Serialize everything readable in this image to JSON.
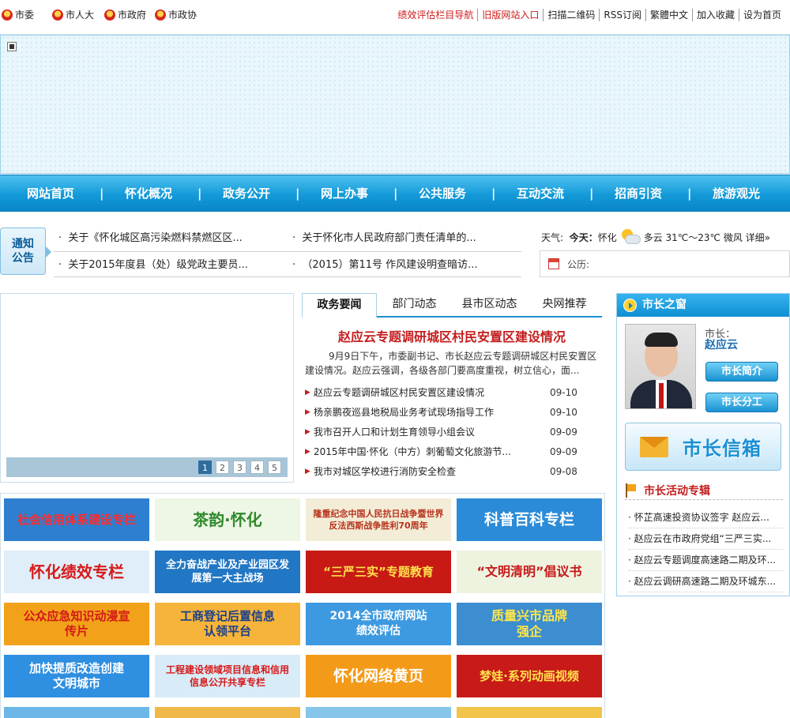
{
  "topbar": {
    "left_links": [
      {
        "label": "市委"
      },
      {
        "label": "市人大"
      },
      {
        "label": "市政府"
      },
      {
        "label": "市政协"
      }
    ],
    "right_links": [
      {
        "label": "绩效评估栏目导航",
        "color": "#d01b1b"
      },
      {
        "label": "旧版网站入口",
        "color": "#d01b1b"
      },
      {
        "label": "扫描二维码",
        "color": "#222222"
      },
      {
        "label": "RSS订阅",
        "color": "#222222"
      },
      {
        "label": "繁體中文",
        "color": "#222222"
      },
      {
        "label": "加入收藏",
        "color": "#222222"
      },
      {
        "label": "设为首页",
        "color": "#222222"
      }
    ]
  },
  "nav": {
    "items": [
      "网站首页",
      "怀化概况",
      "政务公开",
      "网上办事",
      "公共服务",
      "互动交流",
      "招商引资",
      "旅游观光"
    ],
    "separator": "|"
  },
  "notice": {
    "badge_line1": "通知",
    "badge_line2": "公告",
    "bullet": "·",
    "items": [
      "关于《怀化城区高污染燃料禁燃区区...",
      "关于怀化市人民政府部门责任清单的...",
      "关于2015年度县（处）级党政主要员...",
      "（2015）第11号 作风建设明查暗访..."
    ]
  },
  "weather": {
    "label": "天气:",
    "today_label": "今天：",
    "city": "怀化",
    "description": "多云 31℃～23℃ 微风",
    "detail_link": "详细»"
  },
  "almanac": {
    "label": "公历:"
  },
  "slideshow": {
    "pages": [
      "1",
      "2",
      "3",
      "4",
      "5"
    ],
    "active_page": "1"
  },
  "news": {
    "tabs": [
      "政务要闻",
      "部门动态",
      "县市区动态",
      "央网推荐"
    ],
    "active_tab": "政务要闻",
    "headline": "赵应云专题调研城区村民安置区建设情况",
    "summary": "9月9日下午，市委副书记、市长赵应云专题调研城区村民安置区建设情况。赵应云强调，各级各部门要高度重视，树立信心，面...",
    "items": [
      {
        "title": "赵应云专题调研城区村民安置区建设情况",
        "date": "09-10"
      },
      {
        "title": "杨亲鹏夜巡县地税局业务考试现场指导工作",
        "date": "09-10"
      },
      {
        "title": "我市召开人口和计划生育领导小组会议",
        "date": "09-09"
      },
      {
        "title": "2015年中国·怀化（中方）刺葡萄文化旅游节...",
        "date": "09-09"
      },
      {
        "title": "我市对城区学校进行消防安全检查",
        "date": "09-08"
      }
    ]
  },
  "mayor": {
    "header": "市长之窗",
    "title_label": "市长：",
    "name": "赵应云",
    "profile_button": "市长简介",
    "duties_button": "市长分工",
    "mailbox_label": "市长信箱",
    "activity_title": "市长活动专辑",
    "activities": [
      "怀芷高速投资协议签字 赵应云...",
      "赵应云在市政府党组“三严三实...",
      "赵应云专题调度高速路二期及环...",
      "赵应云调研高速路二期及环城东..."
    ]
  },
  "promos": [
    {
      "label": "社会信用体系建设专栏",
      "bg": "#2f7fd0",
      "fg": "#ff2b2b"
    },
    {
      "label": "茶韵·怀化",
      "bg": "#eef6e6",
      "fg": "#2f8a2a"
    },
    {
      "label": "隆重纪念中国人民抗日战争暨世界反法西斯战争胜利70周年",
      "bg": "#f3ecd6",
      "fg": "#b7321c"
    },
    {
      "label": "科普百科专栏",
      "bg": "#2b8bd8",
      "fg": "#ffffff"
    },
    {
      "label": "怀化绩效专栏",
      "bg": "#dfeef8",
      "fg": "#d81818"
    },
    {
      "label": "全力奋战产业及产业园区发展第一大主战场",
      "bg": "#2277c4",
      "fg": "#ffffff"
    },
    {
      "label": "“三严三实”专题教育",
      "bg": "#c71a15",
      "fg": "#ffe24a"
    },
    {
      "label": "“文明清明”倡议书",
      "bg": "#eef3e0",
      "fg": "#c81818"
    },
    {
      "label": "公众应急知识动漫宣传片",
      "bg": "#f2a21a",
      "fg": "#d41818"
    },
    {
      "label": "工商登记后置信息认领平台",
      "bg": "#f6b43a",
      "fg": "#1a3f8a"
    },
    {
      "label": "2014全市政府网站绩效评估",
      "bg": "#3d9ae0",
      "fg": "#ffffff"
    },
    {
      "label": "质量兴市品牌强企",
      "bg": "#3c8ed0",
      "fg": "#ffe64a"
    },
    {
      "label": "加快提质改造创建文明城市",
      "bg": "#2f8fe0",
      "fg": "#ffffff"
    },
    {
      "label": "工程建设领域项目信息和信用信息公开共享专栏",
      "bg": "#d8ecf8",
      "fg": "#d81818"
    },
    {
      "label": "怀化网络黄页",
      "bg": "#f39a18",
      "fg": "#ffffff"
    },
    {
      "label": "梦娃·系列动画视频",
      "bg": "#c81a18",
      "fg": "#ffe24a"
    },
    {
      "label": "",
      "bg": "#6db7e8",
      "fg": "#ffffff"
    },
    {
      "label": "",
      "bg": "#f0b848",
      "fg": "#ffffff"
    },
    {
      "label": "",
      "bg": "#86c6ea",
      "fg": "#ffffff"
    },
    {
      "label": "",
      "bg": "#f2c44a",
      "fg": "#ffffff"
    }
  ]
}
